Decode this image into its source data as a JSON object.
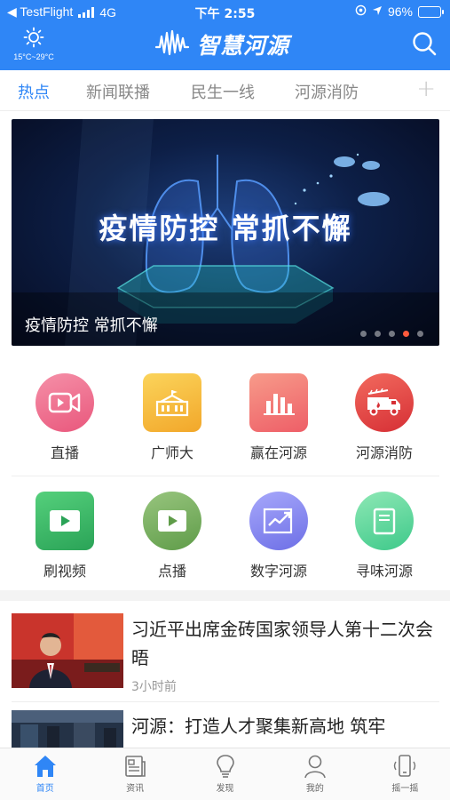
{
  "status_bar": {
    "back_app": "◀ TestFlight",
    "network": "4G",
    "time": "下午 2:55",
    "battery": "96%"
  },
  "header": {
    "weather_icon": "sun-icon",
    "temperature": "15°C~29°C",
    "app_title": "智慧河源",
    "search_icon": "search-icon",
    "theme_color": "#2f86f6"
  },
  "tabs": [
    {
      "label": "热点",
      "active": true
    },
    {
      "label": "新闻联播",
      "active": false
    },
    {
      "label": "民生一线",
      "active": false
    },
    {
      "label": "河源消防",
      "active": false
    }
  ],
  "tab_add": "+",
  "banner": {
    "headline": "疫情防控 常抓不懈",
    "caption": "疫情防控 常抓不懈",
    "slide_count": 5,
    "active_slide": 4,
    "active_dot_color": "#ff5a3c"
  },
  "grid": {
    "row1": [
      {
        "label": "直播",
        "icon": "video-camera-icon",
        "color": "#f07090"
      },
      {
        "label": "广师大",
        "icon": "building-icon",
        "color": "#f5b93a"
      },
      {
        "label": "赢在河源",
        "icon": "bar-chart-icon",
        "color": "#f4706b"
      },
      {
        "label": "河源消防",
        "icon": "fire-truck-icon",
        "color": "#e94040"
      }
    ],
    "row2": [
      {
        "label": "刷视频",
        "icon": "play-icon",
        "color": "#3fbf6b"
      },
      {
        "label": "点播",
        "icon": "play-icon",
        "color": "#7eb766"
      },
      {
        "label": "数字河源",
        "icon": "trend-chart-icon",
        "color": "#8c8ef2"
      },
      {
        "label": "寻味河源",
        "icon": "book-icon",
        "color": "#5fd9a0"
      }
    ]
  },
  "news": [
    {
      "title": "习近平出席金砖国家领导人第十二次会晤",
      "time": "3小时前"
    },
    {
      "title": "河源：打造人才聚集新高地 筑牢",
      "time": ""
    }
  ],
  "bottom_nav": [
    {
      "label": "首页",
      "icon": "home-icon",
      "active": true
    },
    {
      "label": "资讯",
      "icon": "news-icon",
      "active": false
    },
    {
      "label": "发现",
      "icon": "bulb-icon",
      "active": false
    },
    {
      "label": "我的",
      "icon": "user-icon",
      "active": false
    },
    {
      "label": "摇一摇",
      "icon": "phone-shake-icon",
      "active": false
    }
  ]
}
